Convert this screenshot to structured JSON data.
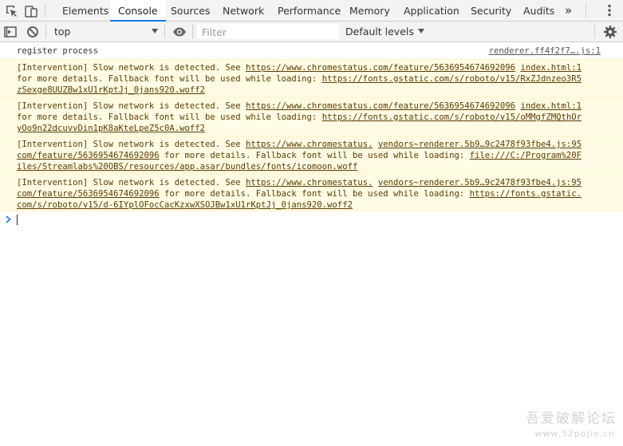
{
  "tabs": [
    "Elements",
    "Console",
    "Sources",
    "Network",
    "Performance",
    "Memory",
    "Application",
    "Security",
    "Audits"
  ],
  "active_tab": "Console",
  "more_tabs": "»",
  "toolbar": {
    "context": "top",
    "filter_placeholder": "Filter",
    "levels": "Default levels"
  },
  "messages": [
    {
      "type": "log",
      "text": "register process",
      "source": "renderer.ff4f2f7….js:1"
    },
    {
      "type": "warning",
      "lines": [
        [
          {
            "t": "[Intervention] Slow network is detected. See "
          },
          {
            "t": "https://www.chromestatus.com/feature/5636954674692096",
            "link": true
          },
          {
            "t": " "
          },
          {
            "t": "index.html:1",
            "link": true
          }
        ],
        [
          {
            "t": "for more details. Fallback font will be used while loading: "
          },
          {
            "t": "https://fonts.gstatic.com/s/roboto/v15/RxZJdnzeo3R5",
            "link": true
          }
        ],
        [
          {
            "t": "zSexge8UUZBw1xU1rKptJj_0jans920.woff2",
            "link": true
          }
        ]
      ]
    },
    {
      "type": "warning",
      "lines": [
        [
          {
            "t": "[Intervention] Slow network is detected. See "
          },
          {
            "t": "https://www.chromestatus.com/feature/5636954674692096",
            "link": true
          },
          {
            "t": " "
          },
          {
            "t": "index.html:1",
            "link": true
          }
        ],
        [
          {
            "t": "for more details. Fallback font will be used while loading: "
          },
          {
            "t": "https://fonts.gstatic.com/s/roboto/v15/oMMgfZMQthOr",
            "link": true
          }
        ],
        [
          {
            "t": "yOo9n22dcuvvDin1pK8aKteLpeZ5c0A.woff2",
            "link": true
          }
        ]
      ]
    },
    {
      "type": "warning",
      "lines": [
        [
          {
            "t": "[Intervention] Slow network is detected. See "
          },
          {
            "t": "https://www.chromestatus.",
            "link": true
          },
          {
            "t": " "
          },
          {
            "t": "vendors~renderer.5b9…9c2478f93fbe4.js:95",
            "link": true
          }
        ],
        [
          {
            "t": "com/feature/5636954674692096",
            "link": true
          },
          {
            "t": " for more details. Fallback font will be used while loading: "
          },
          {
            "t": "file:///C:/Program%20F",
            "link": true
          }
        ],
        [
          {
            "t": "iles/Streamlabs%20OBS/resources/app.asar/bundles/fonts/icomoon.woff",
            "link": true
          }
        ]
      ]
    },
    {
      "type": "warning",
      "lines": [
        [
          {
            "t": "[Intervention] Slow network is detected. See "
          },
          {
            "t": "https://www.chromestatus.",
            "link": true
          },
          {
            "t": " "
          },
          {
            "t": "vendors~renderer.5b9…9c2478f93fbe4.js:95",
            "link": true
          }
        ],
        [
          {
            "t": "com/feature/5636954674692096",
            "link": true
          },
          {
            "t": " for more details. Fallback font will be used while loading: "
          },
          {
            "t": "https://fonts.gstatic.",
            "link": true
          }
        ],
        [
          {
            "t": "com/s/roboto/v15/d-6IYplOFocCacKzxwXSOJBw1xU1rKptJj_0jans920.woff2",
            "link": true
          }
        ]
      ]
    }
  ],
  "prompt_symbol": "›",
  "watermark": {
    "line1": "吾爱破解论坛",
    "line2": "www.52pojie.cn"
  },
  "colors": {
    "active_tab_underline": "#1a73e8",
    "warning_bg": "#fffbe5",
    "warning_text": "#5c3c00",
    "prompt": "#1a73e8"
  }
}
